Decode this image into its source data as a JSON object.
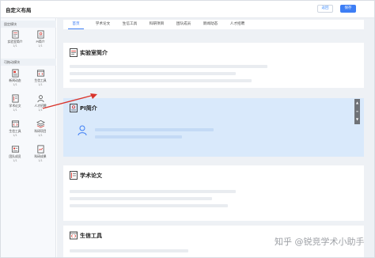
{
  "header": {
    "title": "自定义布局",
    "back_label": "返回",
    "save_label": "保存"
  },
  "sidebar": {
    "section1": "固定模块",
    "section2": "可拖动模块",
    "fixed": [
      {
        "label": "实验室简介",
        "count": "1/1",
        "icon": "document-icon"
      },
      {
        "label": "PI简介",
        "count": "1/1",
        "icon": "id-card-icon"
      }
    ],
    "draggable": [
      {
        "label": "新闻动态",
        "count": "1/1",
        "icon": "news-icon"
      },
      {
        "label": "生信工具",
        "count": "1/1",
        "icon": "code-window-icon"
      },
      {
        "label": "学术论文",
        "count": "1/1",
        "icon": "paper-icon"
      },
      {
        "label": "人才招聘",
        "count": "1/1",
        "icon": "person-icon"
      },
      {
        "label": "生信工具",
        "count": "1/1",
        "icon": "code-window-icon"
      },
      {
        "label": "科研项目",
        "count": "1/1",
        "icon": "layers-icon"
      },
      {
        "label": "团队成员",
        "count": "1/1",
        "icon": "team-icon"
      },
      {
        "label": "科研成果",
        "count": "1/1",
        "icon": "achievement-icon"
      }
    ]
  },
  "tabs": [
    "首页",
    "学术论文",
    "生信工具",
    "科研项目",
    "团队成员",
    "新闻动态",
    "人才招聘"
  ],
  "cards": {
    "lab": "实验室简介",
    "pi": "PI简介",
    "papers": "学术论文",
    "tools": "生信工具"
  },
  "watermark": "知乎 @锐竞学术小助手",
  "colors": {
    "accent": "#3d7ef5",
    "highlight": "#d9e9fb",
    "arrow": "#d9342b"
  }
}
